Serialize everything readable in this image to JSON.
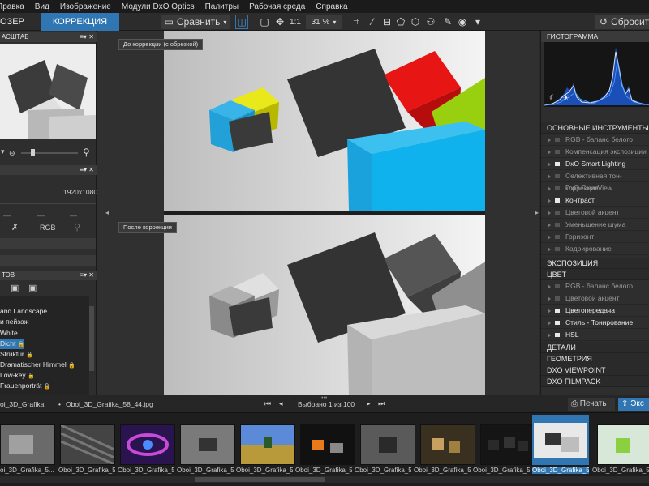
{
  "menu": {
    "items": [
      "Правка",
      "Вид",
      "Изображение",
      "Модули DxO Optics",
      "Палитры",
      "Рабочая среда",
      "Справка"
    ]
  },
  "toolbar": {
    "tab_view": "ОЗЕР",
    "tab_correction": "КОРРЕКЦИЯ",
    "compare_label": "Сравнить",
    "zoom_11": "1:1",
    "zoom_percent": "31 %",
    "reset_label": "Сбросить"
  },
  "left": {
    "scale_title": "АСШТАБ",
    "info_size": "1920x1080",
    "rgb_label": "RGB",
    "presets_title": "ТОВ",
    "presets": [
      "and Landscape",
      "и пейзаж",
      "White",
      "Dicht",
      "Struktur",
      "Dramatischer Himmel",
      "Low-key",
      "Frauenporträt"
    ]
  },
  "center": {
    "before_label": "До коррекции (с обрезкой)",
    "after_label": "После коррекции"
  },
  "right": {
    "histogram_title": "ГИСТОГРАММА",
    "basic_title": "ОСНОВНЫЕ ИНСТРУМЕНТЫ",
    "basic_items": [
      {
        "label": "RGB - баланс белого",
        "on": false
      },
      {
        "label": "Компенсация экспозиции",
        "on": false
      },
      {
        "label": "DxO Smart Lighting",
        "on": true
      },
      {
        "label": "Селективная тон-коррекция",
        "on": false
      },
      {
        "label": "DxO ClearView",
        "on": false
      },
      {
        "label": "Контраст",
        "on": true
      },
      {
        "label": "Цветовой акцент",
        "on": false
      },
      {
        "label": "Уменьшение шума",
        "on": false
      },
      {
        "label": "Горизонт",
        "on": false
      },
      {
        "label": "Кадрирование",
        "on": false
      }
    ],
    "exposure_title": "ЭКСПОЗИЦИЯ",
    "color_title": "ЦВЕТ",
    "color_items": [
      {
        "label": "RGB - баланс белого",
        "on": false
      },
      {
        "label": "Цветовой акцент",
        "on": false
      },
      {
        "label": "Цветопередача",
        "on": true
      },
      {
        "label": "Стиль - Тонирование",
        "on": true
      },
      {
        "label": "HSL",
        "on": true
      }
    ],
    "details_title": "ДЕТАЛИ",
    "geometry_title": "ГЕОМЕТРИЯ",
    "viewpoint_title": "DXO VIEWPOINT",
    "filmpack_title": "DXO FILMPACK"
  },
  "strip": {
    "path_folder": "oi_3D_Grafika",
    "path_sep": "•",
    "path_file": "Oboi_3D_Grafika_58_44.jpg",
    "selected_text": "Выбрано 1 из 100",
    "print_label": "Печать",
    "export_label": "Экс",
    "thumb_labels": [
      "oi_3D_Grafika_5...",
      "Oboi_3D_Grafika_5...",
      "Oboi_3D_Grafika_5...",
      "Oboi_3D_Grafika_5...",
      "Oboi_3D_Grafika_5...",
      "Oboi_3D_Grafika_5...",
      "Oboi_3D_Grafika_5...",
      "Oboi_3D_Grafika_5...",
      "Oboi_3D_Grafika_5...",
      "Oboi_3D_Grafika_5...",
      "Oboi_3D_Grafika_5..."
    ]
  },
  "colors": {
    "accent": "#2f76b2",
    "panel": "#2e2e2e",
    "header": "#3a3a3a"
  }
}
